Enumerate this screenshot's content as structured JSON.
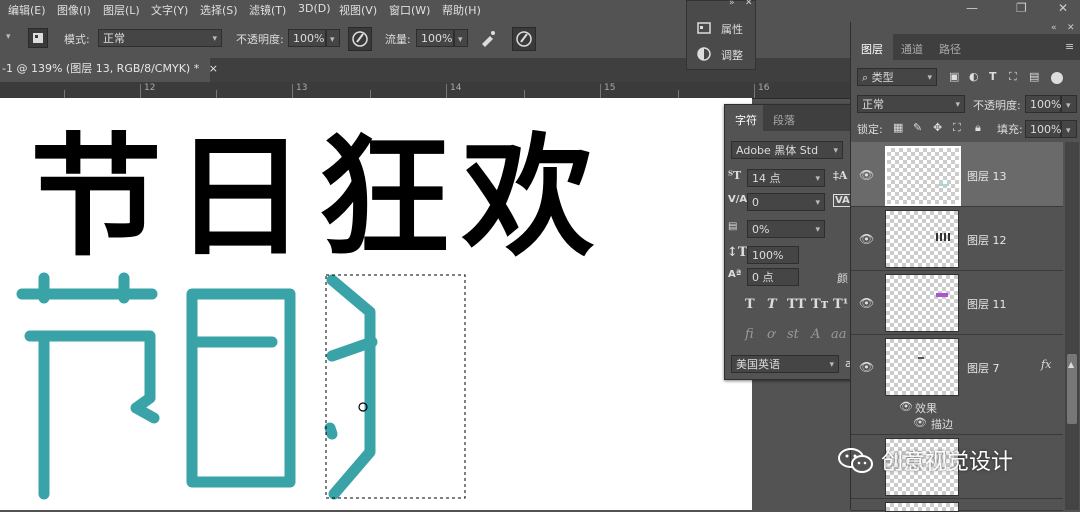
{
  "menu": [
    "编辑(E)",
    "图像(I)",
    "图层(L)",
    "文字(Y)",
    "选择(S)",
    "滤镜(T)",
    "3D(D)",
    "视图(V)",
    "窗口(W)",
    "帮助(H)"
  ],
  "options": {
    "mode_label": "模式:",
    "mode_value": "正常",
    "opacity_label": "不透明度:",
    "opacity_value": "100%",
    "flow_label": "流量:",
    "flow_value": "100%"
  },
  "document_tab": "-1 @ 139% (图层 13, RGB/8/CMYK) *",
  "document_tab_close": "×",
  "ruler_numbers": [
    "12",
    "13",
    "14",
    "15",
    "16"
  ],
  "float_panel": {
    "properties": "属性",
    "adjustments": "调整"
  },
  "canvas": {
    "title_chars": [
      "节",
      "日",
      "狂",
      "欢"
    ]
  },
  "character_panel": {
    "tab_character": "字符",
    "tab_paragraph": "段落",
    "font": "Adobe 黑体 Std",
    "size": "14 点",
    "kerning": "0",
    "tracking": "0%",
    "vertical_scale": "100%",
    "baseline_shift": "0 点",
    "color_label": "颜",
    "language": "美国英语",
    "language_suffix": "a",
    "styles": [
      "T",
      "T",
      "TT",
      "Tт",
      "T¹"
    ],
    "opentype": [
      "fi",
      "ơ",
      "st",
      "A",
      "aa"
    ]
  },
  "layers_panel": {
    "tabs": [
      "图层",
      "通道",
      "路径"
    ],
    "filter_kind": "类型",
    "blend_mode": "正常",
    "opacity_label": "不透明度:",
    "opacity_value": "100%",
    "lock_label": "锁定:",
    "fill_label": "填充:",
    "fill_value": "100%",
    "layers": [
      {
        "name": "图层 13",
        "selected": true
      },
      {
        "name": "图层 12",
        "selected": false
      },
      {
        "name": "图层 11",
        "selected": false
      },
      {
        "name": "图层 7",
        "selected": false,
        "fx": "fx"
      }
    ],
    "effects_label": "效果",
    "stroke_label": "描边"
  },
  "watermark": "创意视觉设计",
  "colors": {
    "teal": "#3aa3a8",
    "panel": "#535353",
    "dark": "#3f3f3f"
  }
}
